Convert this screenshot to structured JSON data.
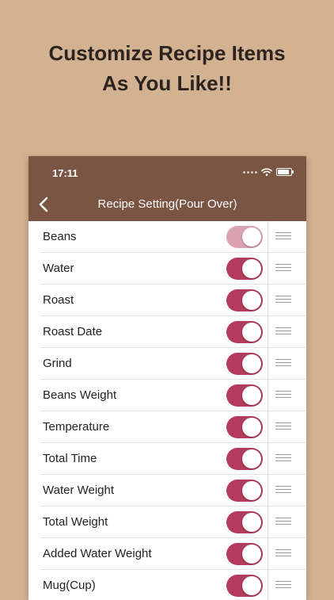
{
  "promo": {
    "line1": "Customize Recipe Items",
    "line2": "As You Like!!"
  },
  "status_bar": {
    "time": "17:11"
  },
  "nav": {
    "title": "Recipe Setting(Pour Over)",
    "back_icon": "chevron-left-icon"
  },
  "colors": {
    "background": "#d3b291",
    "nav_bar": "#7b5544",
    "toggle_on": "#b33b5c",
    "toggle_on_light": "#dba3b1"
  },
  "items": [
    {
      "label": "Beans",
      "enabled": true
    },
    {
      "label": "Water",
      "enabled": true
    },
    {
      "label": "Roast",
      "enabled": true
    },
    {
      "label": "Roast Date",
      "enabled": true
    },
    {
      "label": "Grind",
      "enabled": true
    },
    {
      "label": "Beans Weight",
      "enabled": true
    },
    {
      "label": "Temperature",
      "enabled": true
    },
    {
      "label": "Total Time",
      "enabled": true
    },
    {
      "label": "Water Weight",
      "enabled": true
    },
    {
      "label": "Total Weight",
      "enabled": true
    },
    {
      "label": "Added Water Weight",
      "enabled": true
    },
    {
      "label": "Mug(Cup)",
      "enabled": true
    }
  ]
}
